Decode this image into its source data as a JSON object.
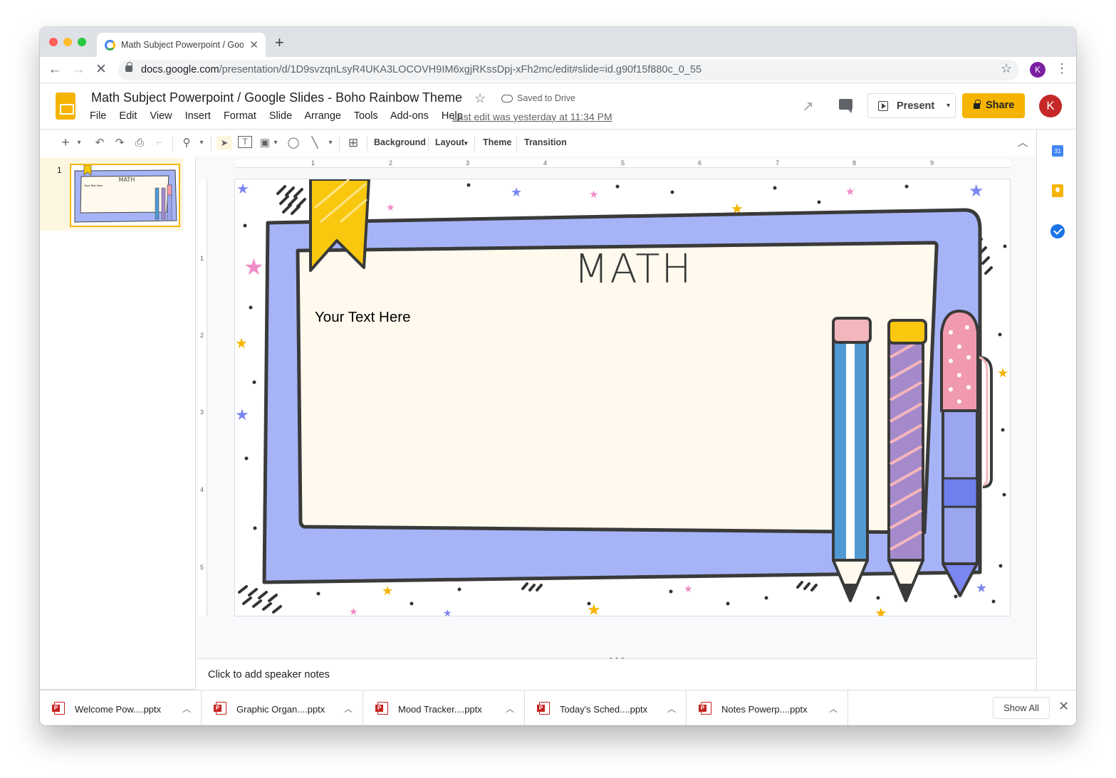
{
  "browser": {
    "tab_title": "Math Subject Powerpoint / Goog",
    "tab_close": "✕",
    "new_tab": "+",
    "url_domain": "docs.google.com",
    "url_path": "/presentation/d/1D9svzqnLsyR4UKA3LOCOVH9IM6xgjRKssDpj-xFh2mc/edit#slide=id.g90f15f880c_0_55",
    "profile_initial": "K",
    "back": "←",
    "forward": "→",
    "reload": "✕",
    "bookmark": "☆",
    "menu": "⋮"
  },
  "header": {
    "doc_title": "Math Subject Powerpoint / Google Slides - Boho Rainbow Theme",
    "title_star": "☆",
    "saved_status": "Saved to Drive",
    "menus": [
      "File",
      "Edit",
      "View",
      "Insert",
      "Format",
      "Slide",
      "Arrange",
      "Tools",
      "Add-ons",
      "Help"
    ],
    "last_edit": "Last edit was yesterday at 11:34 PM",
    "present_label": "Present",
    "present_caret": "▾",
    "share_label": "Share",
    "account_initial": "K",
    "trend": "↗"
  },
  "toolbar": {
    "icons": {
      "new": "+",
      "new_caret": "▾",
      "undo": "↶",
      "redo": "↷",
      "print": "⎙",
      "paint": "⌐",
      "zoom": "⚲",
      "zoom_caret": "▾",
      "select": "➤",
      "textbox": "T",
      "image": "▣",
      "image_caret": "▾",
      "shape": "◯",
      "line": "╲",
      "line_caret": "▾",
      "comment": "⊞"
    },
    "background": "Background",
    "layout": "Layout",
    "layout_caret": "▾",
    "theme": "Theme",
    "transition": "Transition",
    "collapse": "︿"
  },
  "filmstrip": {
    "slide_number": "1",
    "thumb_title": "MATH",
    "thumb_text": "Your Text Here"
  },
  "ruler": {
    "h_numbers": [
      "1",
      "2",
      "3",
      "4",
      "5",
      "6",
      "7",
      "8",
      "9"
    ],
    "v_numbers": [
      "1",
      "2",
      "3",
      "4",
      "5"
    ]
  },
  "slide": {
    "title": "MATH",
    "body_text": "Your Text Here"
  },
  "notes": {
    "placeholder": "Click to add speaker notes",
    "grip": "• • •"
  },
  "sidepanel": {
    "calendar_day": "31",
    "expand": "›"
  },
  "downloads": {
    "items": [
      {
        "name": "Welcome Pow....pptx"
      },
      {
        "name": "Graphic Organ....pptx"
      },
      {
        "name": "Mood Tracker....pptx"
      },
      {
        "name": "Today's Sched....pptx"
      },
      {
        "name": "Notes Powerp....pptx"
      }
    ],
    "caret": "︿",
    "show_all": "Show All",
    "close": "✕"
  },
  "colors": {
    "accent_yellow": "#f6b400",
    "frame_blue": "#a6b4f7",
    "frame_inner": "#fffaed",
    "pencil_pink": "#f19aae",
    "pencil_blue": "#5199d2",
    "pencil_purple": "#a48acb"
  }
}
